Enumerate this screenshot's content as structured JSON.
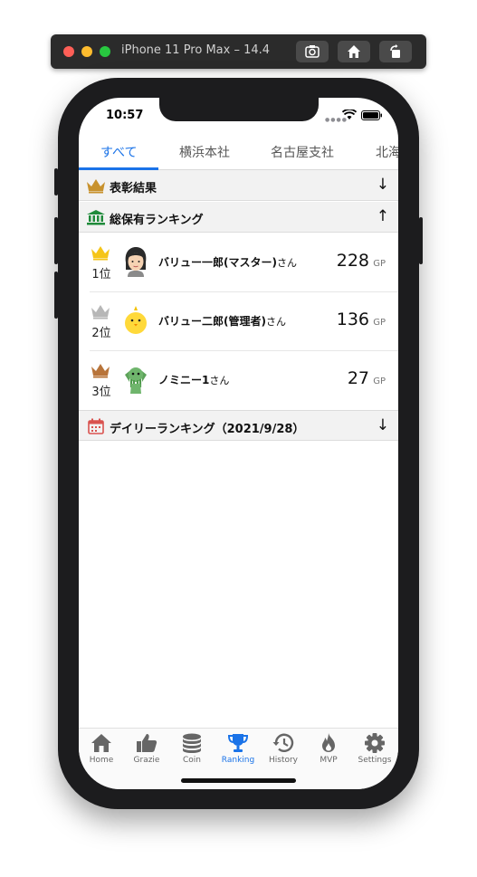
{
  "simulator": {
    "title": "iPhone 11 Pro Max – 14.4"
  },
  "status_bar": {
    "time": "10:57"
  },
  "tabs": [
    {
      "label": "すべて"
    },
    {
      "label": "横浜本社"
    },
    {
      "label": "名古屋支社"
    },
    {
      "label": "北海"
    }
  ],
  "sections": {
    "awards": {
      "label": "表彰結果",
      "arrow": "↓"
    },
    "total": {
      "label": "総保有ランキング",
      "arrow": "↑"
    },
    "daily": {
      "label": "デイリーランキング（2021/9/28）",
      "arrow": "↓"
    }
  },
  "ranking": [
    {
      "rank": "1位",
      "name": "バリュー一郎(マスター)",
      "suffix": "さん",
      "points": "228",
      "unit": "GP",
      "crown_color": "#f5c518"
    },
    {
      "rank": "2位",
      "name": "バリュー二郎(管理者)",
      "suffix": "さん",
      "points": "136",
      "unit": "GP",
      "crown_color": "#b7b7b7"
    },
    {
      "rank": "3位",
      "name": "ノミニー1",
      "suffix": "さん",
      "points": "27",
      "unit": "GP",
      "crown_color": "#b8743a"
    }
  ],
  "nav": [
    {
      "label": "Home",
      "icon": "house-icon"
    },
    {
      "label": "Grazie",
      "icon": "thumbs-up-icon"
    },
    {
      "label": "Coin",
      "icon": "coins-icon"
    },
    {
      "label": "Ranking",
      "icon": "trophy-icon"
    },
    {
      "label": "History",
      "icon": "history-icon"
    },
    {
      "label": "MVP",
      "icon": "fire-icon"
    },
    {
      "label": "Settings",
      "icon": "gear-icon"
    }
  ],
  "colors": {
    "accent": "#1a73e8",
    "crown_gold": "#f5c518",
    "section_crown": "#c8922e",
    "bank_green": "#1f8a3a",
    "calendar_red": "#d9534f"
  }
}
